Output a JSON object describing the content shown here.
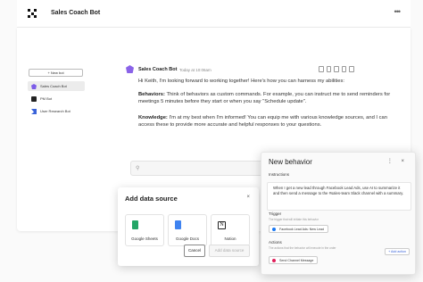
{
  "app": {
    "title": "Sales Coach Bot",
    "more": "•••"
  },
  "sidebar": {
    "new_bot": "+ New bot",
    "items": [
      {
        "label": "Sales Coach Bot",
        "icon": "bot-icon-purple"
      },
      {
        "label": "PM Bot",
        "icon": "bot-icon-black"
      },
      {
        "label": "User Research Bot",
        "icon": "bot-icon-blue"
      }
    ]
  },
  "message": {
    "author": "Sales Coach Bot",
    "time": "Today at 10:06am",
    "p1": "Hi Keith, I'm looking forward to working together! Here's how you can harness my abilities:",
    "p2_bold": "Behaviors:",
    "p2": " Think of behaviors as custom commands.  For example, you can instruct me to send reminders for meetings 5 minutes before they start or when you say \"Schedule update\".",
    "p3_bold": "Knowledge:",
    "p3": " I'm at my best when I'm informed! You can equip me with various knowledge sources, and I can access these to provide more accurate and helpful responses to your questions."
  },
  "add_data_source": {
    "title": "Add data source",
    "close": "×",
    "sources": [
      "Google Sheets",
      "Google Docs",
      "Notion"
    ],
    "cancel": "Cancel",
    "add": "Add data source"
  },
  "new_behavior": {
    "title": "New behavior",
    "controls": "⋮ ×",
    "instructions_label": "Instructions",
    "instructions": "When I get a new lead through Facebook Lead Ads, use AI to summarize it and then send a message to the #sales-team Slack channel with a summary.",
    "trigger_label": "Trigger",
    "trigger_sub": "The trigger that will initiate this behavior",
    "trigger_chip": "Facebook Lead Ads: New Lead",
    "actions_label": "Actions",
    "actions_sub": "The actions that the behavior will execute in the order",
    "action_chip": "Send Channel Message",
    "add_action": "+ Add action"
  },
  "colors": {
    "accent": "#7c5ce8",
    "sheets": "#23a566",
    "docs": "#3f83f0",
    "link": "#3a63d9"
  }
}
